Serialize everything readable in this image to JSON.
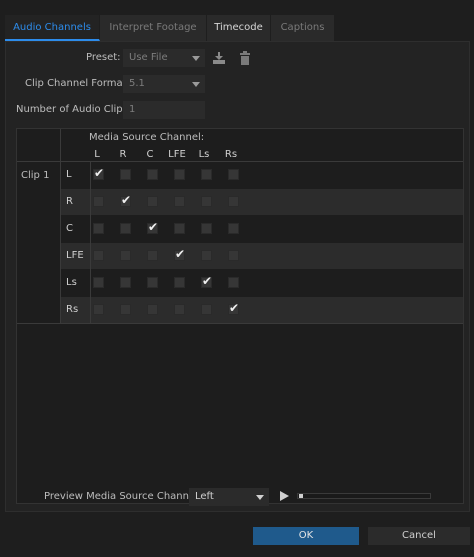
{
  "tabs": [
    {
      "label": "Audio Channels"
    },
    {
      "label": "Interpret Footage"
    },
    {
      "label": "Timecode"
    },
    {
      "label": "Captions"
    }
  ],
  "preset": {
    "label": "Preset:",
    "value": "Use File"
  },
  "clip_channel_format": {
    "label": "Clip Channel Format:",
    "value": "5.1"
  },
  "num_audio_clips": {
    "label": "Number of Audio Clips:",
    "value": "1"
  },
  "grid": {
    "header": "Media Source Channel:",
    "columns": [
      "L",
      "R",
      "C",
      "LFE",
      "Ls",
      "Rs"
    ],
    "clip_label": "Clip 1",
    "rows": [
      {
        "label": "L",
        "checked": [
          true,
          false,
          false,
          false,
          false,
          false
        ]
      },
      {
        "label": "R",
        "checked": [
          false,
          true,
          false,
          false,
          false,
          false
        ]
      },
      {
        "label": "C",
        "checked": [
          false,
          false,
          true,
          false,
          false,
          false
        ]
      },
      {
        "label": "LFE",
        "checked": [
          false,
          false,
          false,
          true,
          false,
          false
        ]
      },
      {
        "label": "Ls",
        "checked": [
          false,
          false,
          false,
          false,
          true,
          false
        ]
      },
      {
        "label": "Rs",
        "checked": [
          false,
          false,
          false,
          false,
          false,
          true
        ]
      }
    ]
  },
  "preview": {
    "label": "Preview Media Source Channel:",
    "value": "Left"
  },
  "buttons": {
    "ok": "OK",
    "cancel": "Cancel"
  },
  "colors": {
    "accent": "#2d8ceb",
    "ok_button": "#1f5a8c",
    "check": "#f0f0f0"
  }
}
